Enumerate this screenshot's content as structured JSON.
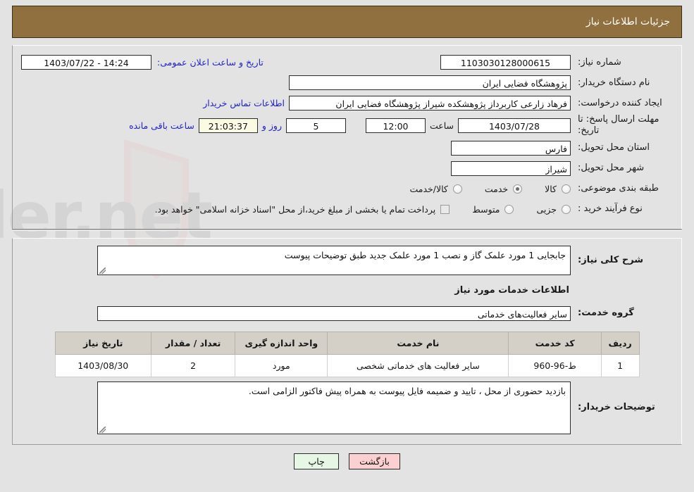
{
  "header": {
    "title": "جزئیات اطلاعات نیاز",
    "bar_color": "#90703f"
  },
  "info": {
    "need_number_label": "شماره نیاز:",
    "need_number_value": "1103030128000615",
    "public_announce_label": "تاریخ و ساعت اعلان عمومی:",
    "public_announce_value": "14:24 - 1403/07/22",
    "buyer_org_label": "نام دستگاه خریدار:",
    "buyer_org_value": "پژوهشگاه فضایی ایران",
    "creator_label": "ایجاد کننده درخواست:",
    "creator_value": "فرهاد زارعی کاربرداز پژوهشکده شیراز پژوهشگاه فضایی ایران",
    "contact_link": "اطلاعات تماس خریدار",
    "deadline_label": "مهلت ارسال پاسخ: تا تاریخ:",
    "deadline_date": "1403/07/28",
    "hour_label": "ساعت",
    "deadline_time": "12:00",
    "days_remaining": "5",
    "days_label": "روز و",
    "time_remaining": "21:03:37",
    "remaining_suffix": "ساعت باقی مانده",
    "province_label": "استان محل تحویل:",
    "province_value": "فارس",
    "city_label": "شهر محل تحویل:",
    "city_value": "شیراز",
    "category_label": "طبقه بندی موضوعی:",
    "category_options": [
      {
        "label": "کالا",
        "checked": false
      },
      {
        "label": "خدمت",
        "checked": true
      },
      {
        "label": "کالا/خدمت",
        "checked": false
      }
    ],
    "process_label": "نوع فرآیند خرید :",
    "process_options": [
      {
        "label": "جزیی",
        "checked": false
      },
      {
        "label": "متوسط",
        "checked": false
      }
    ],
    "treasury_checkbox_label": "پرداخت تمام یا بخشی از مبلغ خرید،از محل \"اسناد خزانه اسلامی\" خواهد بود.",
    "treasury_checked": false
  },
  "need_desc": {
    "label": "شرح کلی نیاز:",
    "value": "جابجایی 1 مورد علمک گاز و نصب 1 مورد علمک جدید طبق توضیحات پیوست"
  },
  "services": {
    "section_title": "اطلاعات خدمات مورد نیاز",
    "group_label": "گروه خدمت:",
    "group_value": "سایر فعالیت‌های خدماتی",
    "columns": [
      "ردیف",
      "کد خدمت",
      "نام خدمت",
      "واحد اندازه گیری",
      "تعداد / مقدار",
      "تاریخ نیاز"
    ],
    "rows": [
      [
        "1",
        "ط-96-960",
        "سایر فعالیت های خدماتی شخصی",
        "مورد",
        "2",
        "1403/08/30"
      ]
    ]
  },
  "buyer_notes": {
    "label": "توضیحات خریدار:",
    "value": "بازدید حضوری از محل ، تایید و ضمیمه فایل پیوست به همراه پیش فاکتور الزامی است."
  },
  "footer": {
    "print_label": "چاپ",
    "back_label": "بازگشت"
  },
  "watermark": {
    "text": "AriaTender.net"
  }
}
